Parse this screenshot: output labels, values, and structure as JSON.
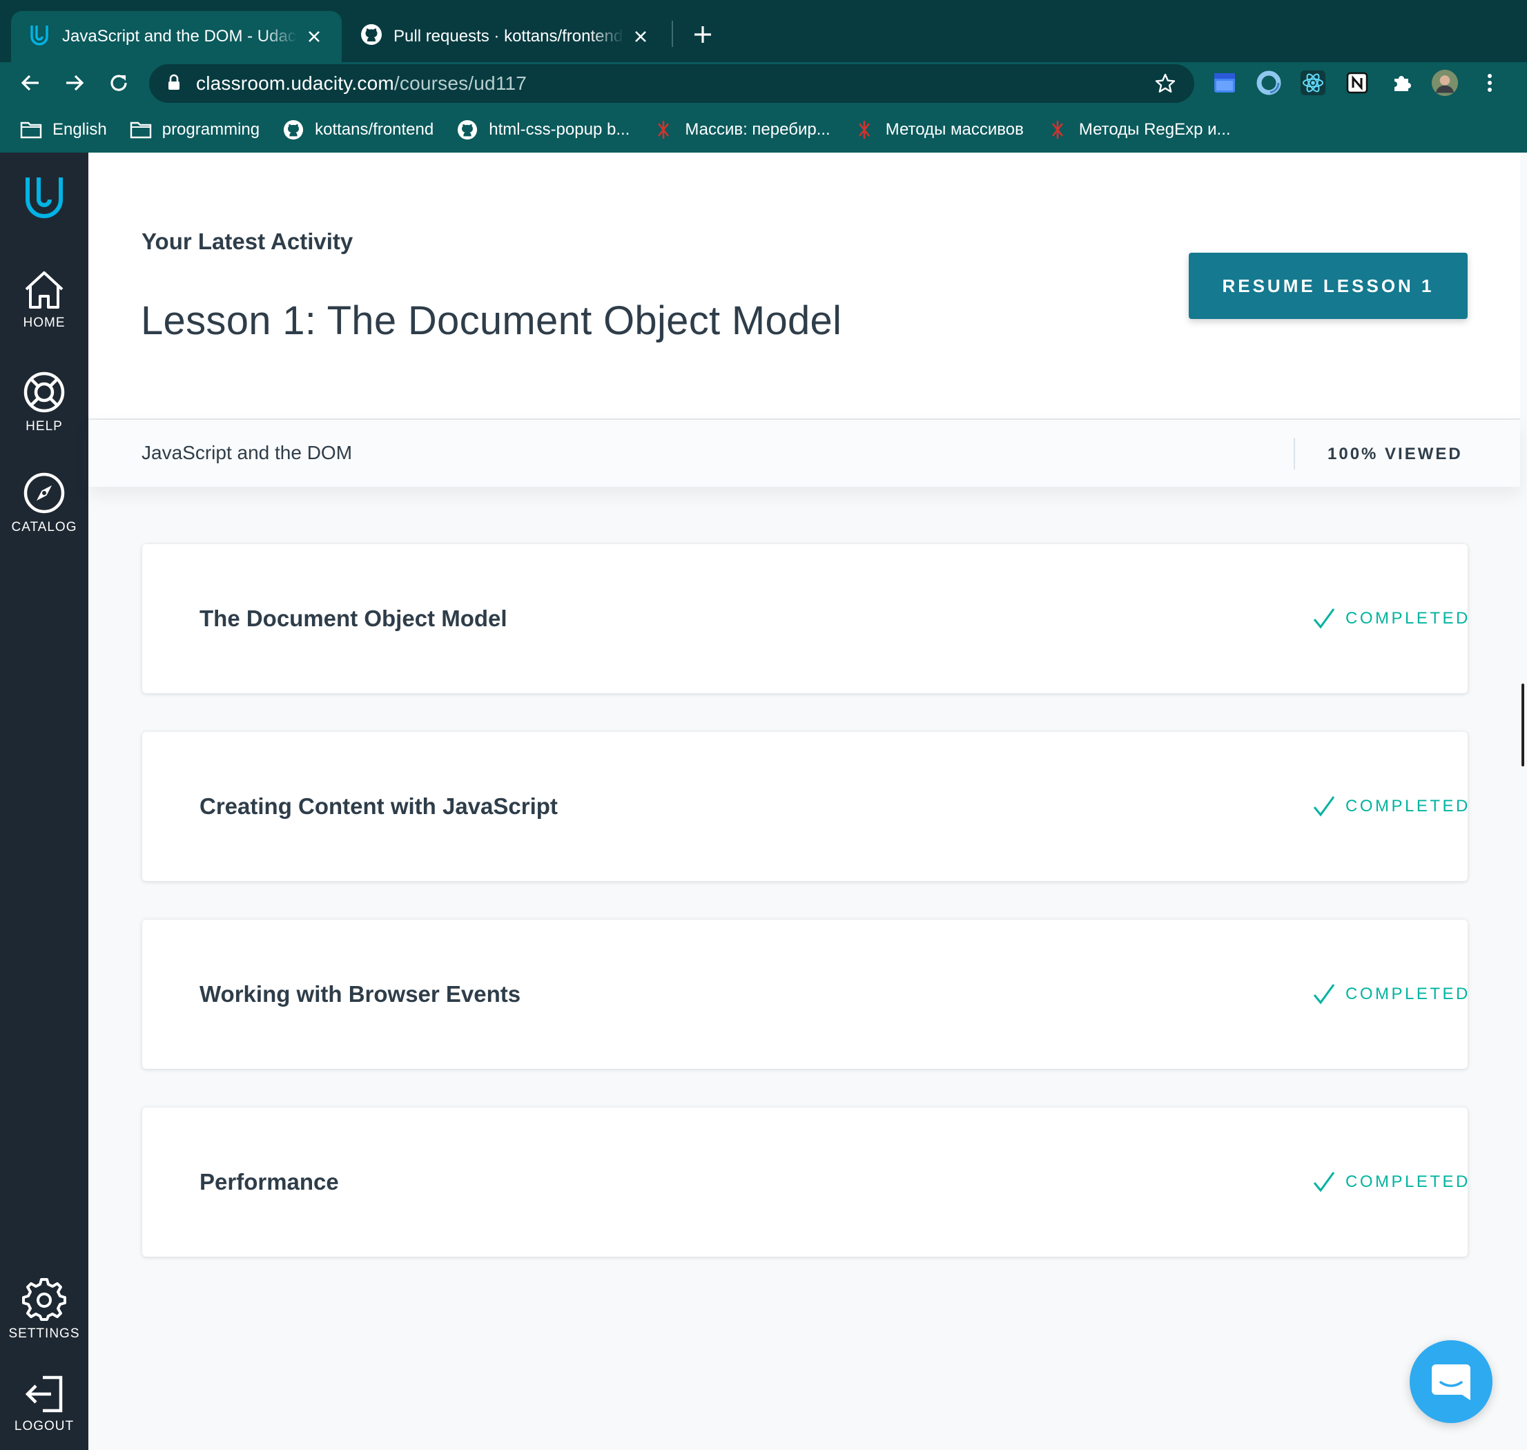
{
  "browser": {
    "tabs": [
      {
        "title": "JavaScript and the DOM - Udacity",
        "active": true,
        "icon": "udacity-icon"
      },
      {
        "title": "Pull requests · kottans/frontend",
        "active": false,
        "icon": "github-icon"
      }
    ],
    "url_host": "classroom.udacity.com",
    "url_path": "/courses/ud117",
    "bookmarks": [
      {
        "label": "English",
        "icon": "folder-icon"
      },
      {
        "label": "programming",
        "icon": "folder-icon"
      },
      {
        "label": "kottans/frontend",
        "icon": "github-icon"
      },
      {
        "label": "html-css-popup b...",
        "icon": "github-icon"
      },
      {
        "label": "Массив: перебир...",
        "icon": "site-icon"
      },
      {
        "label": "Методы массивов",
        "icon": "site-icon"
      },
      {
        "label": "Методы RegExp и...",
        "icon": "site-icon"
      }
    ]
  },
  "sidebar": {
    "items": [
      {
        "label": "HOME",
        "icon": "home-icon"
      },
      {
        "label": "HELP",
        "icon": "help-icon"
      },
      {
        "label": "CATALOG",
        "icon": "compass-icon"
      },
      {
        "label": "SETTINGS",
        "icon": "gear-icon"
      },
      {
        "label": "LOGOUT",
        "icon": "logout-icon"
      }
    ]
  },
  "hero": {
    "kicker": "Your Latest Activity",
    "lesson_title": "Lesson 1: The Document Object Model",
    "resume_label": "RESUME LESSON 1"
  },
  "course": {
    "name": "JavaScript and the DOM",
    "viewed": "100% VIEWED"
  },
  "lessons": [
    {
      "title": "The Document Object Model",
      "status": "COMPLETED"
    },
    {
      "title": "Creating Content with JavaScript",
      "status": "COMPLETED"
    },
    {
      "title": "Working with Browser Events",
      "status": "COMPLETED"
    },
    {
      "title": "Performance",
      "status": "COMPLETED"
    }
  ],
  "colors": {
    "chrome": "#0b5a5c",
    "sidebar": "#1e2832",
    "accent": "#15798f",
    "completed": "#02b3a0",
    "chat": "#2eaaf0"
  }
}
